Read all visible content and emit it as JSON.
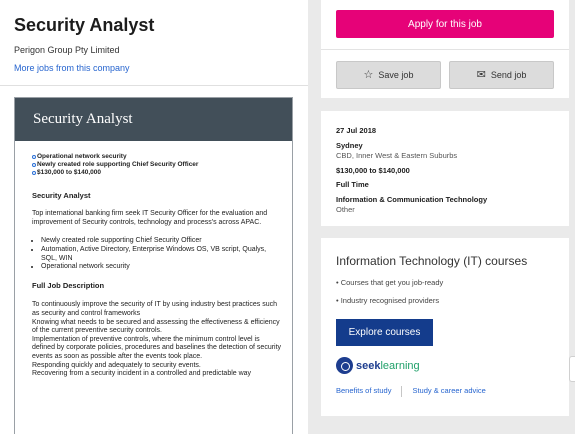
{
  "job": {
    "title": "Security Analyst",
    "company": "Perigon Group Pty Limited",
    "more_jobs_link": "More jobs from this company"
  },
  "ad": {
    "title": "Security Analyst",
    "highlights": [
      "Operational network security",
      "Newly created role supporting Chief Security Officer",
      "$130,000 to $140,000"
    ],
    "section1_heading": "Security Analyst",
    "intro": "Top international banking firm seek IT Security Officer for the evaluation and improvement of Security controls, technology and process's across APAC.",
    "bullets": [
      "Newly created role supporting Chief Security Officer",
      "Automation, Active Directory, Enterprise Windows OS, VB script, Qualys, SQL, WIN",
      "Operational network security"
    ],
    "section2_heading": "Full Job Description",
    "description_lines": [
      "To continuously improve the security of IT by using industry best practices such as security and control frameworks",
      "Knowing what needs to be secured and assessing the effectiveness & efficiency of the current preventive security controls.",
      "Implementation of preventive controls, where the minimum control level is defined by corporate policies, procedures and baselines the detection of security events as soon as possible after the events took place.",
      "Responding quickly and adequately to security events.",
      "Recovering from a security incident in a controlled and predictable way"
    ]
  },
  "actions": {
    "apply_label": "Apply for this job",
    "save_label": "Save job",
    "send_label": "Send job",
    "save_icon": "star-icon",
    "send_icon": "envelope-icon"
  },
  "details": {
    "date": "27 Jul 2018",
    "location": "Sydney",
    "area": "CBD, Inner West & Eastern Suburbs",
    "salary": "$130,000 to $140,000",
    "work_type": "Full Time",
    "classification": "Information & Communication Technology",
    "sub_classification": "Other"
  },
  "courses": {
    "title": "Information Technology (IT) courses",
    "items": [
      "Courses that get you job-ready",
      "Industry recognised providers"
    ],
    "explore_label": "Explore courses",
    "logo_part1": "seek",
    "logo_part2": "learning",
    "links": [
      "Benefits of study",
      "Study & career advice"
    ]
  },
  "colors": {
    "apply": "#e60278",
    "explore": "#143c8c",
    "ad_header": "#424f59",
    "link": "#2765cf"
  }
}
